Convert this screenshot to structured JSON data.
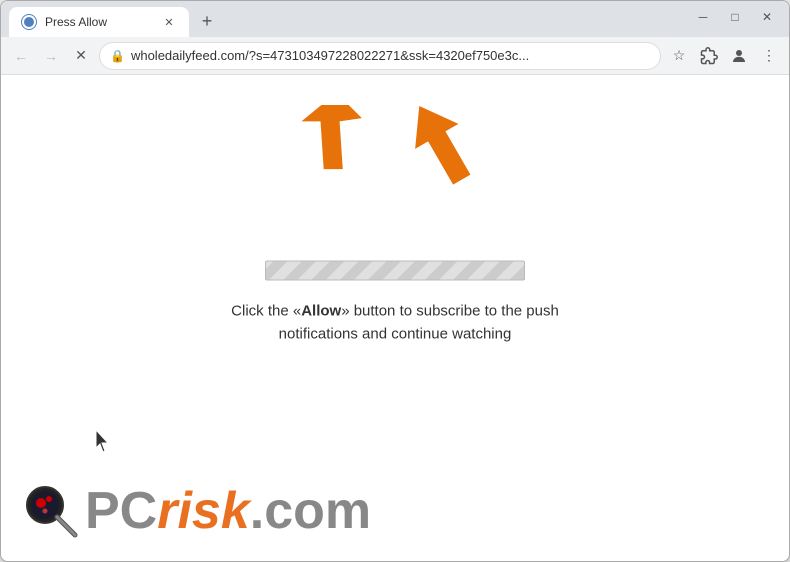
{
  "window": {
    "title": "Press Allow",
    "url": "wholedailyfeed.com/?s=473103497228022271&ssk=4320ef750e3c...",
    "tab_label": "Press Allow"
  },
  "nav": {
    "back_label": "←",
    "forward_label": "→",
    "close_label": "✕",
    "new_tab_label": "+",
    "minimize_label": "─",
    "maximize_label": "□",
    "window_close_label": "✕"
  },
  "page": {
    "progress_text": "",
    "main_text": "Click the «Allow» button to subscribe to the push notifications and continue watching"
  },
  "logo": {
    "pc": "PC",
    "risk": "risk",
    "com": ".com"
  },
  "icons": {
    "lock": "🔒",
    "star": "☆",
    "profile": "👤",
    "menu": "⋮",
    "extension": "🧩"
  }
}
